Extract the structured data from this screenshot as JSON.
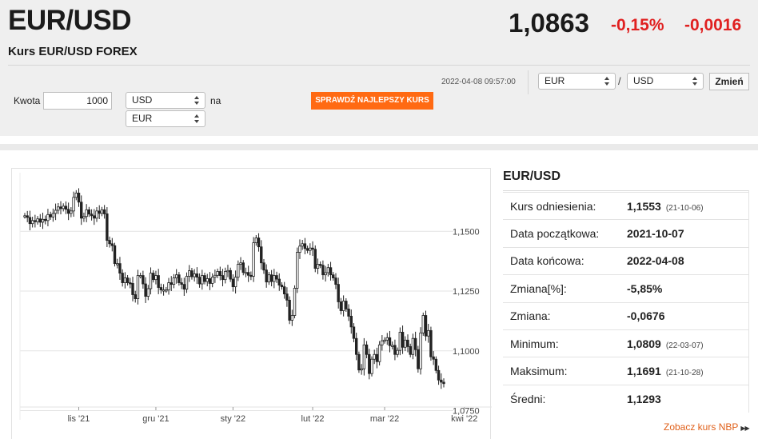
{
  "header": {
    "pair": "EUR/USD",
    "subtitle": "Kurs EUR/USD FOREX",
    "rate": "1,0863",
    "change_pct": "-0,15%",
    "change_abs": "-0,0016"
  },
  "converter": {
    "amount_label": "Kwota",
    "amount_value": "1000",
    "from_currency": "USD",
    "to_label": "na",
    "to_currency": "EUR",
    "best_rate_button": "SPRAWDŹ NAJLEPSZY KURS",
    "timestamp": "2022-04-08 09:57:00",
    "pair_base": "EUR",
    "pair_separator": "/",
    "pair_quote": "USD",
    "change_button": "Zmień"
  },
  "info": {
    "title": "EUR/USD",
    "rows": [
      {
        "label": "Kurs odniesienia:",
        "value": "1,1553",
        "date": "(21-10-06)"
      },
      {
        "label": "Data początkowa:",
        "value": "2021-10-07",
        "date": ""
      },
      {
        "label": "Data końcowa:",
        "value": "2022-04-08",
        "date": ""
      },
      {
        "label": "Zmiana[%]:",
        "value": "-5,85%",
        "date": ""
      },
      {
        "label": "Zmiana:",
        "value": "-0,0676",
        "date": ""
      },
      {
        "label": "Minimum:",
        "value": "1,0809",
        "date": "(22-03-07)"
      },
      {
        "label": "Maksimum:",
        "value": "1,1691",
        "date": "(21-10-28)"
      },
      {
        "label": "Średni:",
        "value": "1,1293",
        "date": ""
      }
    ],
    "nbp_link": "Zobacz kurs NBP"
  },
  "colors": {
    "accent_orange": "#ff6a13",
    "negative_red": "#e02020",
    "panel_bg": "#efefef",
    "candle": "#222222"
  },
  "chart_data": {
    "type": "candlestick",
    "title": "",
    "xlabel": "",
    "ylabel": "",
    "ylim": [
      1.0725,
      1.1745
    ],
    "grid": true,
    "y_ticks": [
      "1,0750",
      "1,1000",
      "1,1250",
      "1,1500"
    ],
    "y_tick_values": [
      1.075,
      1.1,
      1.125,
      1.15
    ],
    "x_ticks": [
      "lis '21",
      "gru '21",
      "sty '22",
      "lut '22",
      "mar '22",
      "kwi '22"
    ],
    "x_tick_positions": [
      21,
      51,
      81,
      112,
      140,
      171
    ],
    "close_values": [
      1.1565,
      1.1558,
      1.1532,
      1.1545,
      1.154,
      1.1552,
      1.1538,
      1.155,
      1.1545,
      1.157,
      1.156,
      1.1575,
      1.1588,
      1.1602,
      1.1595,
      1.1605,
      1.1592,
      1.1575,
      1.1585,
      1.1642,
      1.166,
      1.1622,
      1.1555,
      1.1562,
      1.159,
      1.1572,
      1.1565,
      1.1555,
      1.1585,
      1.1575,
      1.159,
      1.1573,
      1.1462,
      1.1448,
      1.144,
      1.1365,
      1.1365,
      1.1325,
      1.1285,
      1.1305,
      1.1285,
      1.1282,
      1.1235,
      1.1218,
      1.1315,
      1.1315,
      1.128,
      1.1228,
      1.126,
      1.1325,
      1.1298,
      1.1315,
      1.1265,
      1.1255,
      1.1255,
      1.1255,
      1.1285,
      1.1278,
      1.1305,
      1.1318,
      1.1285,
      1.1278,
      1.1258,
      1.1312,
      1.1335,
      1.131,
      1.1322,
      1.1308,
      1.128,
      1.1315,
      1.129,
      1.1302,
      1.1282,
      1.1308,
      1.1316,
      1.1332,
      1.1315,
      1.1298,
      1.1332,
      1.1336,
      1.13,
      1.1268,
      1.1308,
      1.1362,
      1.1368,
      1.1328,
      1.1328,
      1.1316,
      1.1312,
      1.1452,
      1.1472,
      1.1435,
      1.1368,
      1.1338,
      1.1288,
      1.1318,
      1.129,
      1.1315,
      1.13,
      1.1275,
      1.1268,
      1.1238,
      1.1212,
      1.1128,
      1.1148,
      1.1262,
      1.1412,
      1.1438,
      1.1448,
      1.1428,
      1.142,
      1.143,
      1.1425,
      1.1345,
      1.1362,
      1.1358,
      1.1318,
      1.1327,
      1.1348,
      1.1318,
      1.1305,
      1.1278,
      1.1205,
      1.1168,
      1.1208,
      1.1175,
      1.1145,
      1.11,
      1.1052,
      1.0985,
      1.092,
      1.0925,
      1.1025,
      1.0985,
      1.0905,
      1.0965,
      1.0985,
      1.0955,
      1.1025,
      1.1042,
      1.1045,
      1.1055,
      1.1022,
      1.1023,
      1.0985,
      1.1002,
      1.1078,
      1.1015,
      1.1045,
      1.1018,
      1.0985,
      1.1052,
      1.1005,
      1.0925,
      1.1075,
      1.1148,
      1.1062,
      1.1085,
      1.0975,
      1.0965,
      1.0918,
      1.0878,
      1.0869,
      1.0863
    ],
    "y_min_marked": 1.0809,
    "y_max_marked": 1.1691
  }
}
